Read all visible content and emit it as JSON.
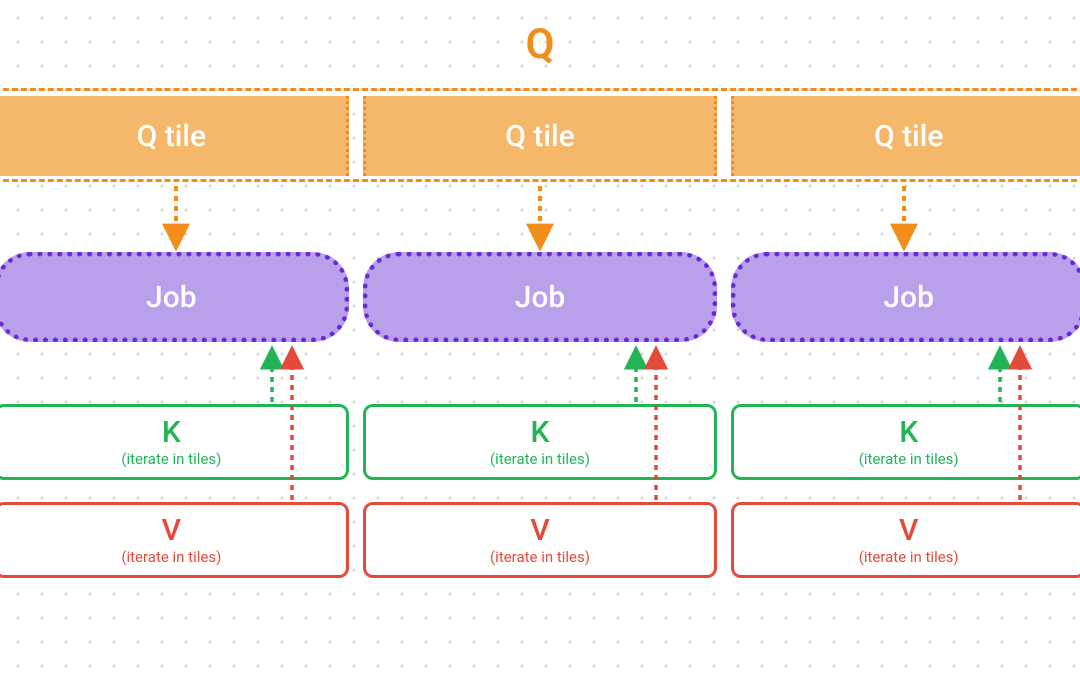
{
  "diagram": {
    "title": "Q",
    "qtiles": [
      {
        "label": "Q tile"
      },
      {
        "label": "Q tile"
      },
      {
        "label": "Q tile"
      }
    ],
    "jobs": [
      {
        "label": "Job"
      },
      {
        "label": "Job"
      },
      {
        "label": "Job"
      }
    ],
    "k": {
      "label": "K",
      "sub": "(iterate in tiles)"
    },
    "v": {
      "label": "V",
      "sub": "(iterate in tiles)"
    },
    "colors": {
      "orange": "#f28c1a",
      "orange_fill": "#f5b76a",
      "purple": "#6a28d9",
      "purple_fill": "#b8a0ea",
      "green": "#22b455",
      "red": "#e44a3a"
    }
  }
}
